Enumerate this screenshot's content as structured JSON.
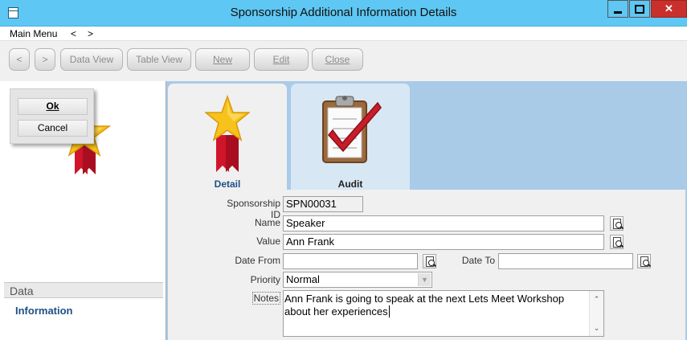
{
  "window": {
    "title": "Sponsorship Additional Information Details",
    "minimize_icon": "minimize-icon",
    "maximize_icon": "maximize-icon",
    "close_glyph": "✕"
  },
  "menubar": {
    "main_menu": "Main Menu",
    "back": "<",
    "forward": ">"
  },
  "toolbar": {
    "prev": "<",
    "next": ">",
    "data_view": "Data View",
    "table_view": "Table View",
    "new": "New",
    "edit": "Edit",
    "close": "Close"
  },
  "popup": {
    "ok": "Ok",
    "cancel": "Cancel"
  },
  "sidebar": {
    "section": "Data",
    "item": "Information"
  },
  "tabs": [
    {
      "label": "Detail",
      "icon": "star-ribbon-icon",
      "active": true
    },
    {
      "label": "Audit",
      "icon": "clipboard-check-icon",
      "active": false
    }
  ],
  "form": {
    "sponsorship_id_label": "Sponsorship ID",
    "sponsorship_id_value": "SPN00031",
    "name_label": "Name",
    "name_value": "Speaker",
    "value_label": "Value",
    "value_value": "Ann Frank",
    "date_from_label": "Date From",
    "date_from_value": "",
    "date_to_label": "Date To",
    "date_to_value": "",
    "priority_label": "Priority",
    "priority_value": "Normal",
    "notes_label": "Notes",
    "notes_line1": "Ann Frank is going to speak at the next Lets Meet Workshop",
    "notes_line2": "about her experiences"
  },
  "colors": {
    "titlebar": "#5ec7f3",
    "close_button": "#c9302c",
    "tab_area": "#a9cbe8",
    "link": "#1e4f86"
  }
}
